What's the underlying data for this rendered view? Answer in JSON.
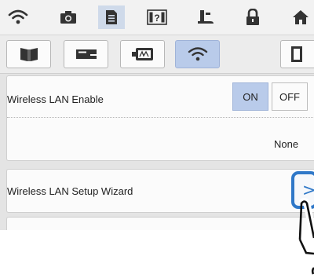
{
  "toolbar": {
    "icons": [
      {
        "name": "wifi-icon",
        "active": false
      },
      {
        "name": "camera-icon",
        "active": false
      },
      {
        "name": "document-icon",
        "active": true
      },
      {
        "name": "help-icon",
        "active": false
      },
      {
        "name": "sewing-foot-icon",
        "active": false
      },
      {
        "name": "lock-icon",
        "active": false
      },
      {
        "name": "home-icon",
        "active": false
      }
    ]
  },
  "subtabs": [
    {
      "name": "manual-tab",
      "active": false
    },
    {
      "name": "machine-tab",
      "active": false
    },
    {
      "name": "embroidery-tab",
      "active": false
    },
    {
      "name": "wireless-tab",
      "active": true
    },
    {
      "name": "frame-tab",
      "active": false
    }
  ],
  "settings": {
    "wireless_enable_label": "Wireless LAN Enable",
    "on_label": "ON",
    "off_label": "OFF",
    "network_value": "None",
    "wizard_label": "Wireless LAN Setup Wizard",
    "wizard_chevron": ">"
  },
  "colors": {
    "active_tab": "#b9cbea",
    "highlight_blue": "#2f78c8"
  }
}
